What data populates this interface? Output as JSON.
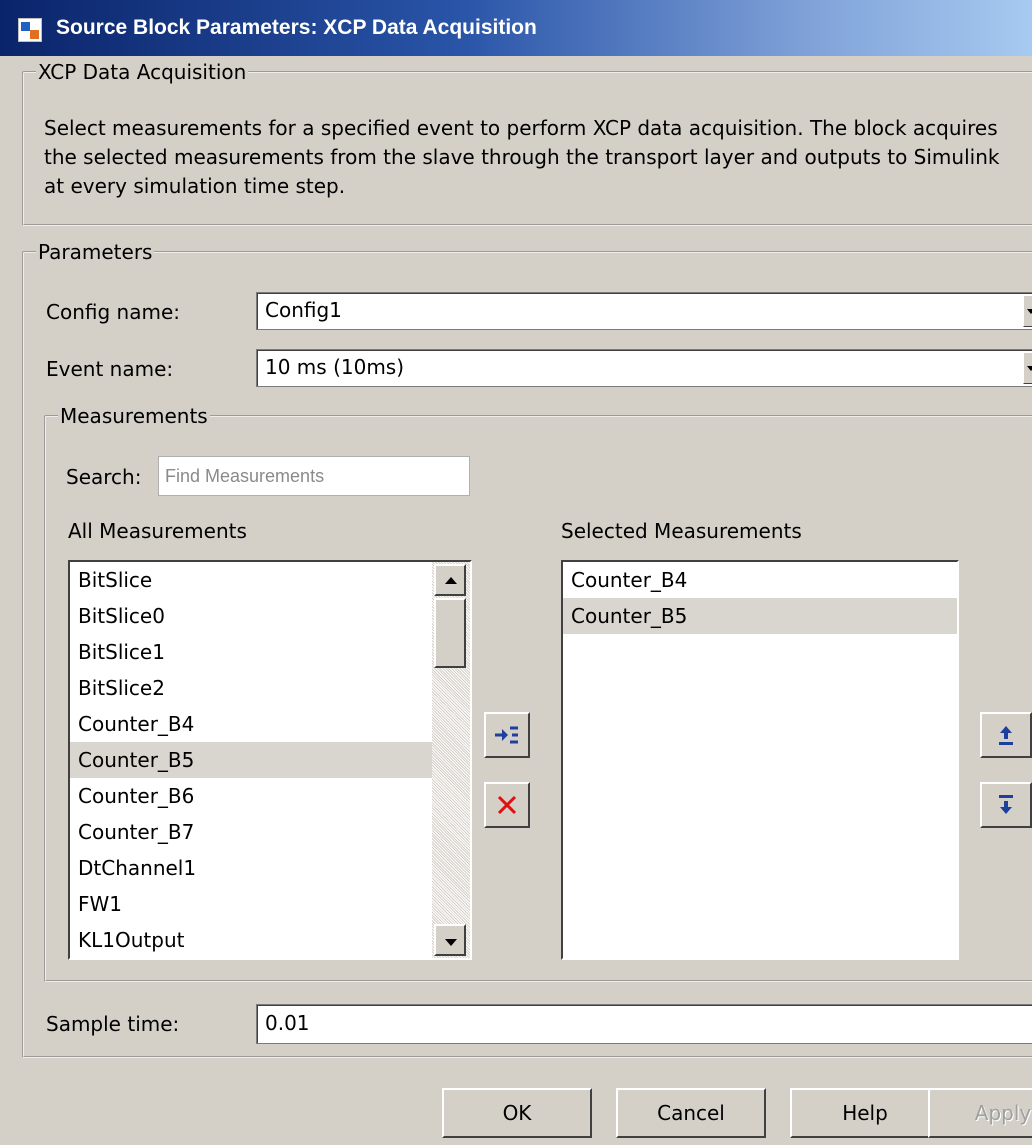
{
  "window": {
    "title": "Source Block Parameters: XCP Data Acquisition",
    "accent_color": "#0a246a",
    "icon": "simulink-block-icon"
  },
  "description_group": {
    "legend": "XCP Data Acquisition",
    "text": "Select measurements for a specified event to perform XCP data acquisition. The block acquires the selected measurements from the slave through the transport layer and outputs to Simulink at every simulation time step."
  },
  "parameters": {
    "legend": "Parameters",
    "config_name_label": "Config name:",
    "config_name_value": "Config1",
    "event_name_label": "Event name:",
    "event_name_value": "10 ms (10ms)",
    "sample_time_label": "Sample time:",
    "sample_time_value": "0.01"
  },
  "measurements": {
    "legend": "Measurements",
    "search_label": "Search:",
    "search_placeholder": "Find Measurements",
    "all_label": "All Measurements",
    "selected_label": "Selected Measurements",
    "all_items": [
      "BitSlice",
      "BitSlice0",
      "BitSlice1",
      "BitSlice2",
      "Counter_B4",
      "Counter_B5",
      "Counter_B6",
      "Counter_B7",
      "DtChannel1",
      "FW1",
      "KL1Output"
    ],
    "all_selected_item": "Counter_B5",
    "selected_items": [
      "Counter_B4",
      "Counter_B5"
    ],
    "selected_highlight_item": "Counter_B5"
  },
  "buttons": {
    "ok": "OK",
    "cancel": "Cancel",
    "help": "Help",
    "apply": "Apply"
  }
}
